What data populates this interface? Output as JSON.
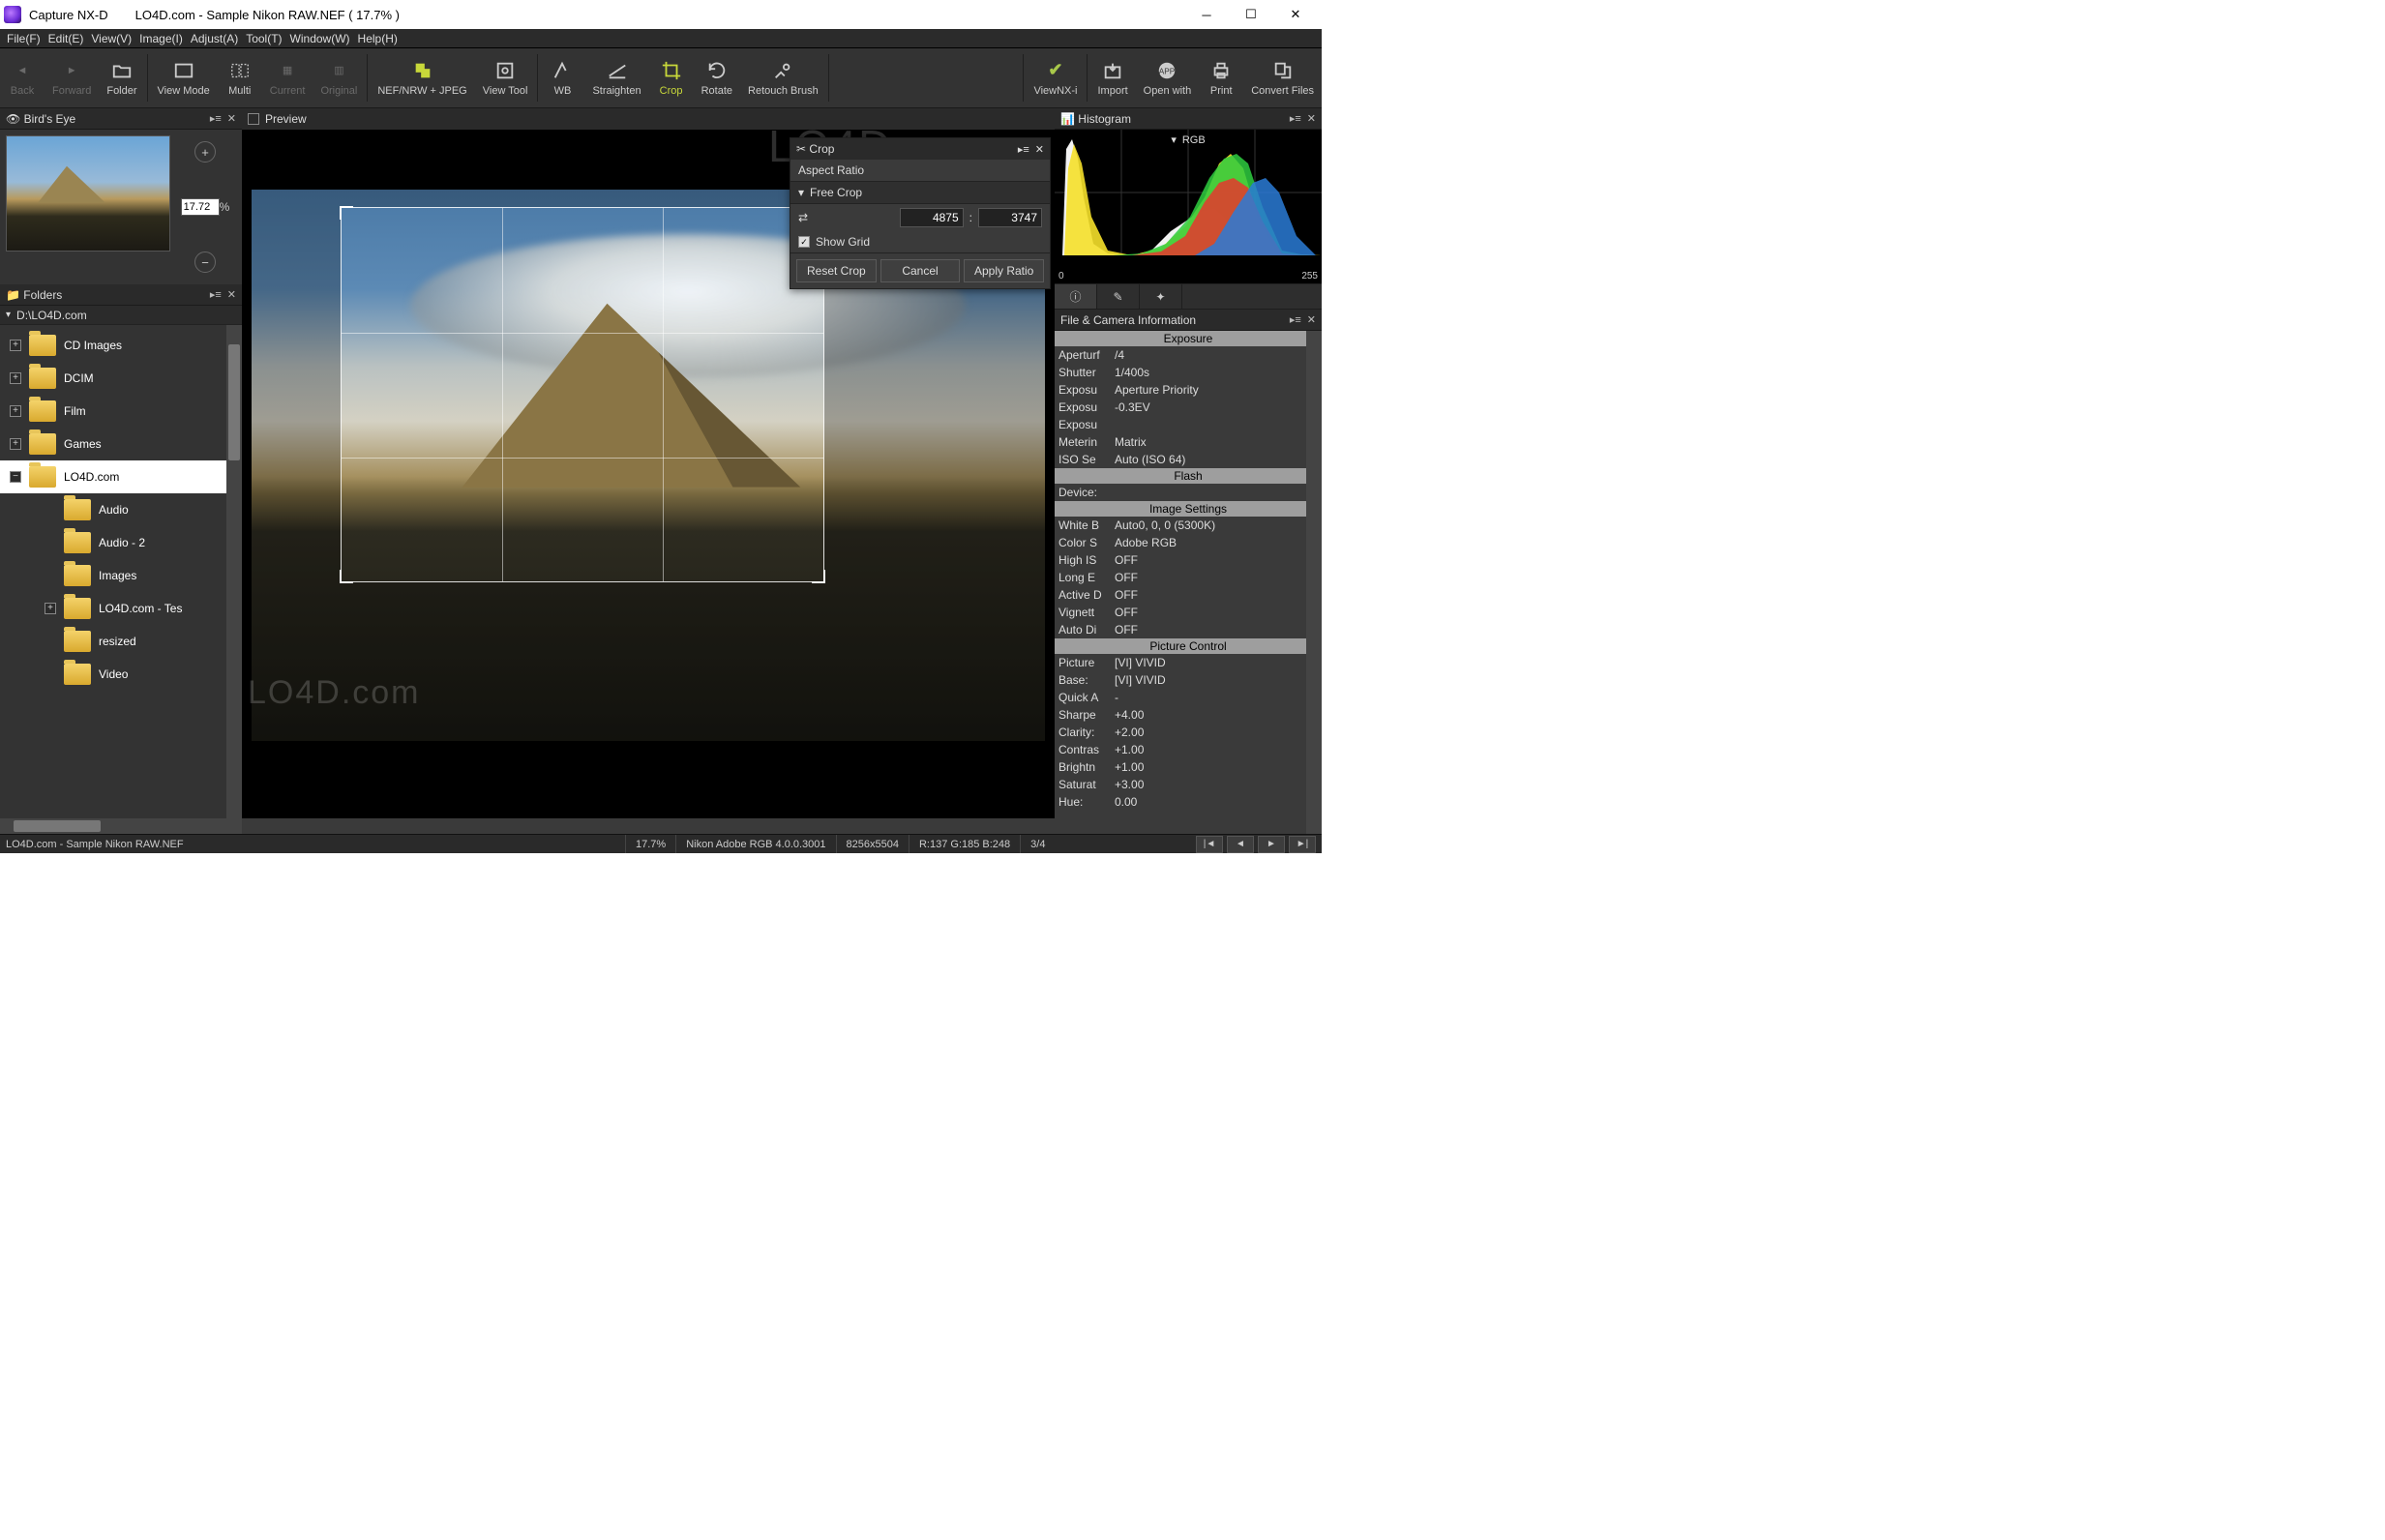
{
  "title": {
    "app": "Capture NX-D",
    "doc": "LO4D.com - Sample Nikon RAW.NEF ( 17.7% )"
  },
  "menu": [
    "File(F)",
    "Edit(E)",
    "View(V)",
    "Image(I)",
    "Adjust(A)",
    "Tool(T)",
    "Window(W)",
    "Help(H)"
  ],
  "toolbar": {
    "back": "Back",
    "forward": "Forward",
    "folder": "Folder",
    "view_mode": "View Mode",
    "multi": "Multi",
    "current": "Current",
    "original": "Original",
    "nef": "NEF/NRW + JPEG",
    "view_tool": "View Tool",
    "wb": "WB",
    "straighten": "Straighten",
    "crop": "Crop",
    "rotate": "Rotate",
    "retouch": "Retouch Brush",
    "viewnx": "ViewNX-i",
    "import": "Import",
    "open_with": "Open with",
    "print": "Print",
    "convert": "Convert Files"
  },
  "birdseye": {
    "title": "Bird's Eye",
    "zoom": "17.72",
    "zoom_suffix": "%"
  },
  "folders": {
    "title": "Folders",
    "path": "D:\\LO4D.com",
    "tree": [
      {
        "d": 0,
        "exp": "+",
        "name": "CD Images"
      },
      {
        "d": 0,
        "exp": "+",
        "name": "DCIM"
      },
      {
        "d": 0,
        "exp": "+",
        "name": "Film"
      },
      {
        "d": 0,
        "exp": "+",
        "name": "Games"
      },
      {
        "d": 0,
        "exp": "−",
        "name": "LO4D.com",
        "sel": true
      },
      {
        "d": 1,
        "exp": "",
        "name": "Audio"
      },
      {
        "d": 1,
        "exp": "",
        "name": "Audio - 2"
      },
      {
        "d": 1,
        "exp": "",
        "name": "Images"
      },
      {
        "d": 1,
        "exp": "+",
        "name": "LO4D.com - Tes"
      },
      {
        "d": 1,
        "exp": "",
        "name": "resized"
      },
      {
        "d": 1,
        "exp": "",
        "name": "Video"
      }
    ]
  },
  "preview": {
    "label": "Preview"
  },
  "crop": {
    "title": "Crop",
    "aspect_label": "Aspect Ratio",
    "mode": "Free Crop",
    "w": "4875",
    "h": "3747",
    "sep": ":",
    "show_grid": "Show Grid",
    "reset": "Reset Crop",
    "cancel": "Cancel",
    "apply": "Apply Ratio"
  },
  "histogram": {
    "title": "Histogram",
    "channel": "RGB",
    "min": "0",
    "max": "255"
  },
  "info": {
    "title": "File & Camera Information",
    "sections": {
      "exposure": "Exposure",
      "flash": "Flash",
      "image": "Image Settings",
      "picture": "Picture Control"
    },
    "exposure": [
      [
        "Aperturf",
        "/4"
      ],
      [
        "Shutter",
        "1/400s"
      ],
      [
        "Exposu",
        "Aperture Priority"
      ],
      [
        "Exposu",
        "-0.3EV"
      ],
      [
        "Exposu",
        ""
      ],
      [
        "Meterin",
        "Matrix"
      ],
      [
        "ISO Se",
        "Auto (ISO 64)"
      ]
    ],
    "flash": [
      [
        "Device:",
        ""
      ]
    ],
    "image": [
      [
        "White B",
        "Auto0, 0, 0 (5300K)"
      ],
      [
        "Color S",
        "Adobe RGB"
      ],
      [
        "High IS",
        "OFF"
      ],
      [
        "Long E",
        "OFF"
      ],
      [
        "Active D",
        "OFF"
      ],
      [
        "Vignett",
        "OFF"
      ],
      [
        "Auto Di",
        "OFF"
      ]
    ],
    "picture": [
      [
        "Picture",
        "[VI] VIVID"
      ],
      [
        "Base:",
        "[VI] VIVID"
      ],
      [
        "Quick A",
        "-"
      ],
      [
        "Sharpe",
        "+4.00"
      ],
      [
        "Clarity:",
        "+2.00"
      ],
      [
        "Contras",
        "+1.00"
      ],
      [
        "Brightn",
        "+1.00"
      ],
      [
        "Saturat",
        "+3.00"
      ],
      [
        "Hue:",
        "0.00"
      ]
    ]
  },
  "status": {
    "file": "LO4D.com - Sample Nikon RAW.NEF",
    "zoom": "17.7%",
    "profile": "Nikon Adobe RGB 4.0.0.3001",
    "dims": "8256x5504",
    "rgb": "R:137 G:185 B:248",
    "index": "3/4"
  }
}
